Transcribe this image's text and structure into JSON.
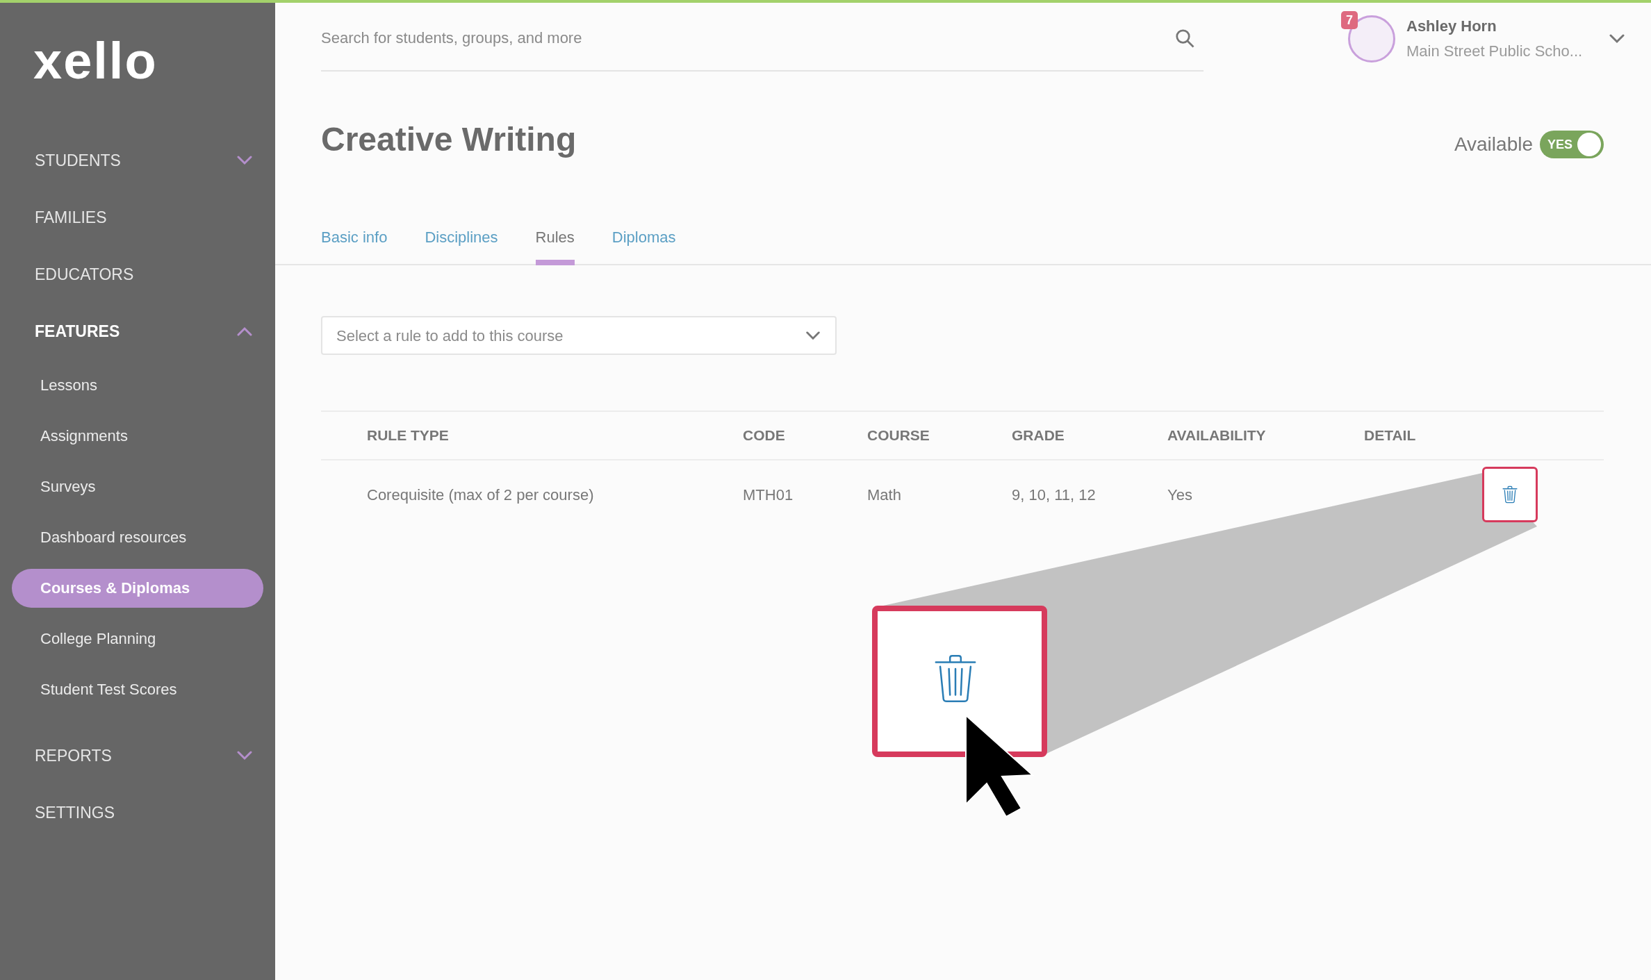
{
  "logo": "xello",
  "sidebar": {
    "items": [
      {
        "kind": "section",
        "label": "STUDENTS",
        "expanded": false
      },
      {
        "kind": "link",
        "label": "FAMILIES"
      },
      {
        "kind": "link",
        "label": "EDUCATORS"
      },
      {
        "kind": "section",
        "label": "FEATURES",
        "expanded": true,
        "children": [
          {
            "label": "Lessons",
            "selected": false
          },
          {
            "label": "Assignments",
            "selected": false
          },
          {
            "label": "Surveys",
            "selected": false
          },
          {
            "label": "Dashboard resources",
            "selected": false
          },
          {
            "label": "Courses & Diplomas",
            "selected": true
          },
          {
            "label": "College Planning",
            "selected": false
          },
          {
            "label": "Student Test Scores",
            "selected": false
          }
        ]
      },
      {
        "kind": "section",
        "label": "REPORTS",
        "expanded": false
      },
      {
        "kind": "link",
        "label": "SETTINGS"
      }
    ]
  },
  "search": {
    "placeholder": "Search for students, groups, and more"
  },
  "user": {
    "name": "Ashley Horn",
    "school": "Main Street Public Scho...",
    "notifications": "7"
  },
  "page": {
    "title": "Creative Writing",
    "availability": {
      "label": "Available",
      "toggle_text": "YES",
      "on": true
    }
  },
  "tabs": [
    {
      "label": "Basic info",
      "selected": false
    },
    {
      "label": "Disciplines",
      "selected": false
    },
    {
      "label": "Rules",
      "selected": true
    },
    {
      "label": "Diplomas",
      "selected": false
    }
  ],
  "rule_select": {
    "placeholder": "Select a rule to add to this course"
  },
  "table": {
    "columns": [
      "RULE TYPE",
      "CODE",
      "COURSE",
      "GRADE",
      "AVAILABILITY",
      "DETAIL"
    ],
    "rows": [
      {
        "cells": [
          "Corequisite (max of 2 per course)",
          "MTH01",
          "Math",
          "9, 10, 11, 12",
          "Yes"
        ]
      }
    ]
  }
}
